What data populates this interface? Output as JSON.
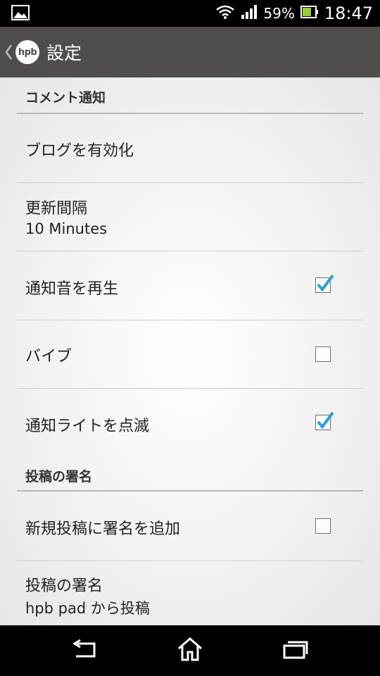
{
  "status_bar": {
    "battery_percent": "59%",
    "time": "18:47",
    "icons": [
      "image-notification-icon",
      "wifi-icon",
      "signal-icon",
      "battery-icon"
    ]
  },
  "action_bar": {
    "logo_text": "hpb",
    "title": "設定"
  },
  "sections": [
    {
      "header": "コメント通知"
    },
    {
      "header": "投稿の署名"
    }
  ],
  "preferences": {
    "enable_blog": {
      "title": "ブログを有効化"
    },
    "update_interval": {
      "title": "更新間隔",
      "summary": "10 Minutes"
    },
    "notification_sound": {
      "title": "通知音を再生",
      "checked": true
    },
    "vibrate": {
      "title": "バイブ",
      "checked": false
    },
    "notification_light": {
      "title": "通知ライトを点滅",
      "checked": true
    },
    "add_signature": {
      "title": "新規投稿に署名を追加",
      "checked": false
    },
    "signature": {
      "title": "投稿の署名",
      "summary": "hpb pad から投稿"
    }
  },
  "colors": {
    "action_bar": "#4f4e4a",
    "check_accent": "#2a9fd6"
  }
}
